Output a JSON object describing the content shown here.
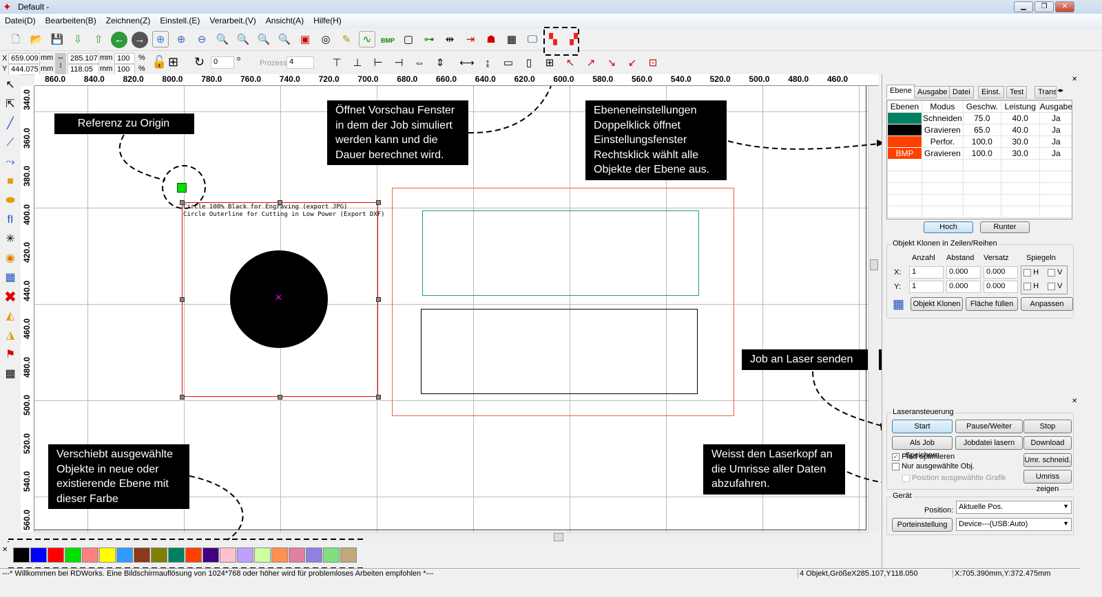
{
  "window": {
    "title": "Default -",
    "min": "▁",
    "max": "❐",
    "close": "✕"
  },
  "menu": [
    "Datei(D)",
    "Bearbeiten(B)",
    "Zeichnen(Z)",
    "Einstell.(E)",
    "Verarbeit.(V)",
    "Ansicht(A)",
    "Hilfe(H)"
  ],
  "toolbar1_icons": [
    "new-file",
    "open-folder",
    "save",
    "import",
    "export",
    "back",
    "forward",
    "zoom-pan",
    "zoom-in",
    "zoom-out",
    "zoom-page",
    "zoom-select",
    "zoom-fit",
    "zoom-custom",
    "rect-frame",
    "center-dot",
    "pen-edit",
    "curve",
    "bmp",
    "square",
    "tree",
    "align",
    "align2",
    "laser",
    "grid",
    "preview-monitor",
    "layer-color",
    "layer-color2"
  ],
  "toolbar2": {
    "x_label": "X",
    "y_label": "Y",
    "x": "659.009",
    "y": "444.075",
    "unit": "mm",
    "w": "285.107",
    "h": "118.05",
    "sx": "100",
    "sy": "100",
    "pct": "%",
    "rot": "0",
    "deg": "o",
    "prozess_label": "Prozess",
    "prozess": "4"
  },
  "ruler_top": [
    "860.0",
    "840.0",
    "820.0",
    "800.0",
    "780.0",
    "760.0",
    "740.0",
    "720.0",
    "700.0",
    "680.0",
    "660.0",
    "640.0",
    "620.0",
    "600.0",
    "580.0",
    "560.0",
    "540.0",
    "520.0",
    "500.0",
    "480.0",
    "460.0"
  ],
  "ruler_left": [
    "340.0",
    "360.0",
    "380.0",
    "400.0",
    "420.0",
    "440.0",
    "460.0",
    "480.0",
    "500.0",
    "520.0",
    "540.0",
    "560.0"
  ],
  "canvas": {
    "text1": "Circle 100% Black for Engraving (export JPG)",
    "text2": "Circle Outerline for Cutting in Low Power (Export DXF)"
  },
  "notes": {
    "origin": "Referenz zu Origin",
    "preview": "Öffnet Vorschau Fenster in dem  der Job simuliert werden kann und die Dauer berechnet wird.",
    "layers": "Ebeneneinstellungen Doppelklick öffnet Einstellungsfenster Rechtsklick wählt alle Objekte der Ebene aus.",
    "send": "Job an Laser senden",
    "move": "Verschiebt ausgewählte Objekte in neue oder existierende  Ebene mit dieser Farbe",
    "frame": "Weisst den Laserkopf an die Umrisse aller Daten abzufahren."
  },
  "palette": [
    "#000000",
    "#0000ff",
    "#ff0000",
    "#00e000",
    "#ff8080",
    "#ffff00",
    "#3399ff",
    "#8b3a1a",
    "#808000",
    "#008060",
    "#ff4000",
    "#400080",
    "#ffc0d0",
    "#c0a0ff",
    "#d0ffa0",
    "#ff9050",
    "#e080a0",
    "#9080e0",
    "#80e080",
    "#c0a878"
  ],
  "right": {
    "tabs": [
      "Ebene",
      "Ausgabe",
      "Datei",
      "Einst.",
      "Test",
      "Trans"
    ],
    "layer_headers": [
      "Ebenen",
      "Modus",
      "Geschw.",
      "Leistung",
      "Ausgabe"
    ],
    "layers": [
      {
        "color": "#008060",
        "label": "",
        "mode": "Schneiden",
        "speed": "75.0",
        "power": "40.0",
        "out": "Ja"
      },
      {
        "color": "#000000",
        "label": "",
        "mode": "Gravieren",
        "speed": "65.0",
        "power": "40.0",
        "out": "Ja"
      },
      {
        "color": "#ff4000",
        "label": "",
        "mode": "Perfor.",
        "speed": "100.0",
        "power": "30.0",
        "out": "Ja"
      },
      {
        "color": "#ff4000",
        "label": "BMP",
        "mode": "Gravieren",
        "speed": "100.0",
        "power": "30.0",
        "out": "Ja"
      }
    ],
    "up": "Hoch",
    "down": "Runter",
    "clone_title": "Objekt Klonen in Zeilen/Reihen",
    "clone_headers": [
      "Anzahl",
      "Abstand",
      "Versatz",
      "Spiegeln"
    ],
    "x_label": "X:",
    "y_label": "Y:",
    "x_count": "1",
    "x_dist": "0.000",
    "x_off": "0.000",
    "y_count": "1",
    "y_dist": "0.000",
    "y_off": "0.000",
    "h": "H",
    "v": "V",
    "clone_btn": "Objekt Klonen",
    "fill_btn": "Fläche füllen",
    "fit_btn": "Anpassen",
    "laser_title": "Laseransteuerung",
    "start": "Start",
    "pause": "Pause/Weiter",
    "stop": "Stop",
    "save_job": "Als Job Speichern",
    "run_file": "Jobdatei lasern",
    "download": "Download",
    "opt_path": "Pfad optimieren",
    "opt_path_checked": true,
    "only_sel": "Nur ausgewählte Obj.",
    "pos_sel": "Position ausgewählte Grafik",
    "cut_frame": "Umr. schneid.",
    "show_frame": "Umriss zeigen",
    "device_title": "Gerät",
    "position_label": "Position:",
    "position_value": "Aktuelle Pos.",
    "port_btn": "Porteinstellung",
    "device_value": "Device---(USB:Auto)"
  },
  "status": {
    "msg": "---* Willkommen bei RDWorks. Eine Bildschirmauflösung von 1024*768 oder höher wird für problemloses Arbeiten empfohlen *---",
    "objects": "4 Objekt,GrößeX285.107,Y118.050",
    "coords": "X:705.390mm,Y:372.475mm"
  }
}
